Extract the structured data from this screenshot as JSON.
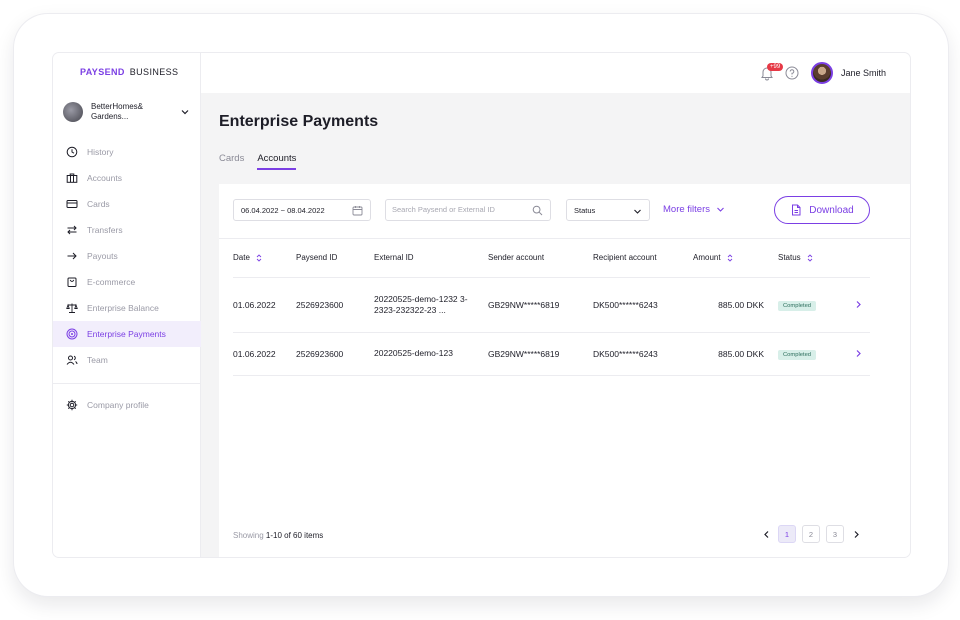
{
  "brand": {
    "name": "PAYSEND",
    "sub": "BUSINESS"
  },
  "org": {
    "name": "BetterHomes& Gardens..."
  },
  "nav": [
    {
      "label": "History",
      "icon": "clock-icon"
    },
    {
      "label": "Accounts",
      "icon": "briefcase-icon"
    },
    {
      "label": "Cards",
      "icon": "card-icon"
    },
    {
      "label": "Transfers",
      "icon": "transfer-icon"
    },
    {
      "label": "Payouts",
      "icon": "arrow-right-icon"
    },
    {
      "label": "E-commerce",
      "icon": "shopping-bag-icon"
    },
    {
      "label": "Enterprise Balance",
      "icon": "scales-icon"
    },
    {
      "label": "Enterprise Payments",
      "icon": "target-icon",
      "active": true
    },
    {
      "label": "Team",
      "icon": "users-icon"
    }
  ],
  "nav_profile": {
    "label": "Company profile",
    "icon": "gear-icon"
  },
  "header": {
    "notifications_badge": "+99",
    "user_name": "Jane Smith"
  },
  "page": {
    "title": "Enterprise Payments",
    "tabs": [
      {
        "label": "Cards"
      },
      {
        "label": "Accounts",
        "active": true
      }
    ]
  },
  "filters": {
    "date_range": "06.04.2022 ~ 08.04.2022",
    "search_placeholder": "Search Paysend or External ID",
    "status_label": "Status",
    "more_filters_label": "More filters",
    "download_label": "Download"
  },
  "table": {
    "columns": [
      "Date",
      "Paysend ID",
      "External ID",
      "Sender account",
      "Recipient account",
      "Amount",
      "Status"
    ],
    "rows": [
      {
        "date": "01.06.2022",
        "paysend_id": "2526923600",
        "external_id": "20220525-demo-1232 3-2323-232322-23 ...",
        "sender": "GB29NW*****6819",
        "recipient": "DK500******6243",
        "amount": "885.00 DKK",
        "status": "Completed"
      },
      {
        "date": "01.06.2022",
        "paysend_id": "2526923600",
        "external_id": "20220525-demo-123",
        "sender": "GB29NW*****6819",
        "recipient": "DK500******6243",
        "amount": "885.00 DKK",
        "status": "Completed"
      }
    ]
  },
  "pagination": {
    "showing_prefix": "Showing",
    "showing_range": "1-10 of 60 items",
    "pages": [
      "1",
      "2",
      "3"
    ],
    "current": "1"
  },
  "colors": {
    "accent": "#7b3fe4",
    "status_completed_bg": "#d8efe9",
    "notification": "#e63946"
  }
}
